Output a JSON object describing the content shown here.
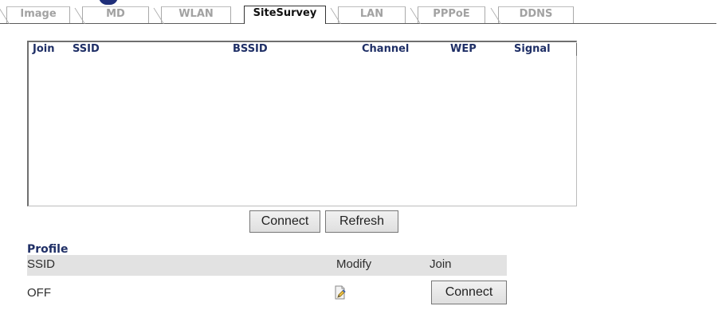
{
  "tabs": [
    {
      "label": "Image",
      "active": false
    },
    {
      "label": "MD",
      "active": false
    },
    {
      "label": "WLAN",
      "active": false
    },
    {
      "label": "SiteSurvey",
      "active": true
    },
    {
      "label": "LAN",
      "active": false
    },
    {
      "label": "PPPoE",
      "active": false
    },
    {
      "label": "DDNS",
      "active": false
    }
  ],
  "survey": {
    "headers": {
      "join": "Join",
      "ssid": "SSID",
      "bssid": "BSSID",
      "channel": "Channel",
      "wep": "WEP",
      "signal": "Signal"
    },
    "rows": []
  },
  "actions": {
    "connect_label": "Connect",
    "refresh_label": "Refresh"
  },
  "profile": {
    "title": "Profile",
    "headers": {
      "ssid": "SSID",
      "modify": "Modify",
      "join": "Join"
    },
    "rows": [
      {
        "ssid": "OFF",
        "modify_icon": "edit-document-icon",
        "join_button": "Connect"
      }
    ]
  },
  "colors": {
    "header_text": "#1f2f66",
    "profile_header_bg": "#e2e2e2",
    "inactive_tab_text": "#a2a2a2"
  }
}
